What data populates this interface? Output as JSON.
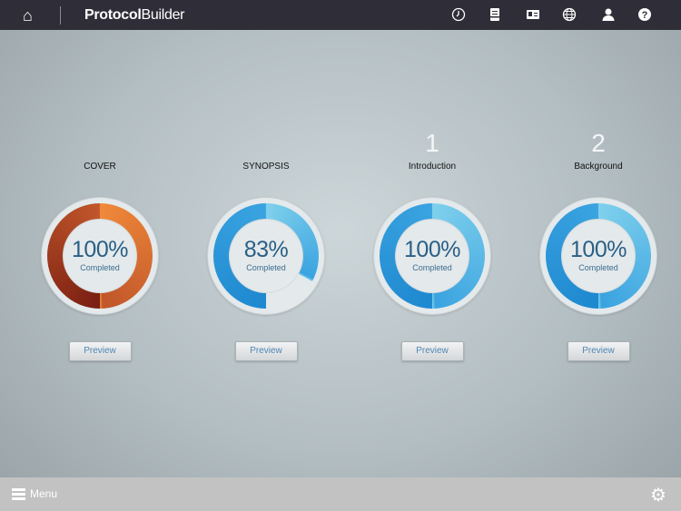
{
  "header": {
    "brand_bold": "Protocol",
    "brand_light": "Builder",
    "icons": [
      "clock-icon",
      "document-icon",
      "id-card-icon",
      "globe-icon",
      "user-icon",
      "help-icon"
    ]
  },
  "sections": [
    {
      "number": "",
      "title": "COVER",
      "percent": 100,
      "percent_label": "100%",
      "status": "Completed",
      "button": "Preview",
      "colors": [
        "#7a1e12",
        "#c0562a",
        "#f0893a"
      ]
    },
    {
      "number": "",
      "title": "SYNOPSIS",
      "percent": 83,
      "percent_label": "83%",
      "status": "Completed",
      "button": "Preview",
      "colors": [
        "#1e88d0",
        "#3aa3e0",
        "#7fd0ec"
      ]
    },
    {
      "number": "1",
      "title": "Introduction",
      "percent": 100,
      "percent_label": "100%",
      "status": "Completed",
      "button": "Preview",
      "colors": [
        "#1e88d0",
        "#3aa3e0",
        "#7fd0ec"
      ]
    },
    {
      "number": "2",
      "title": "Background",
      "percent": 100,
      "percent_label": "100%",
      "status": "Completed",
      "button": "Preview",
      "colors": [
        "#1e88d0",
        "#3aa3e0",
        "#7fd0ec"
      ]
    }
  ],
  "footer": {
    "menu_label": "Menu"
  }
}
